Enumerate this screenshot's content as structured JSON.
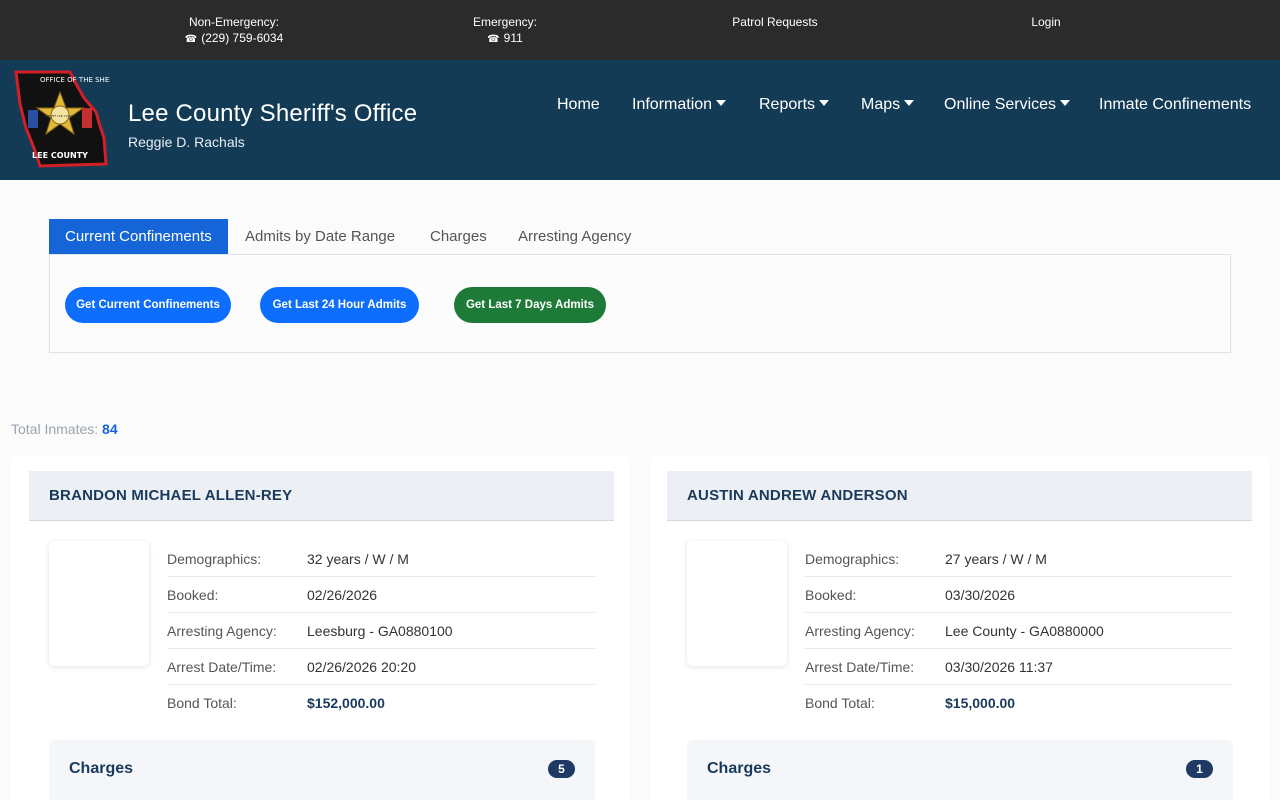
{
  "topbar": {
    "non_emergency_label": "Non-Emergency:",
    "non_emergency_phone": "(229) 759-6034",
    "emergency_label": "Emergency:",
    "emergency_phone": "911",
    "patrol_requests": "Patrol Requests",
    "login": "Login",
    "icon": "phone-icon"
  },
  "header": {
    "title": "Lee County Sheriff's Office",
    "subtitle": "Reggie D. Rachals",
    "logo_text_top": "OFFICE OF THE SHERIFF",
    "logo_text_bottom": "LEE COUNTY",
    "logo_star_text": "SHERIFF LEE COUNTY"
  },
  "nav": {
    "items": [
      {
        "label": "Home",
        "dropdown": false
      },
      {
        "label": "Information",
        "dropdown": true
      },
      {
        "label": "Reports",
        "dropdown": true
      },
      {
        "label": "Maps",
        "dropdown": true
      },
      {
        "label": "Online Services",
        "dropdown": true
      },
      {
        "label": "Inmate Confinements",
        "dropdown": false
      }
    ]
  },
  "tabs": {
    "items": [
      {
        "label": "Current Confinements",
        "active": true
      },
      {
        "label": "Admits by Date Range",
        "active": false
      },
      {
        "label": "Charges",
        "active": false
      },
      {
        "label": "Arresting Agency",
        "active": false
      }
    ]
  },
  "buttons": {
    "current": "Get Current Confinements",
    "last24": "Get Last 24 Hour Admits",
    "last7": "Get Last 7 Days Admits"
  },
  "total": {
    "label": "Total Inmates:",
    "count": "84"
  },
  "labels": {
    "demographics": "Demographics:",
    "booked": "Booked:",
    "agency": "Arresting Agency:",
    "arrest": "Arrest Date/Time:",
    "bond": "Bond Total:",
    "charges": "Charges"
  },
  "inmates": [
    {
      "name": "BRANDON MICHAEL ALLEN-REY",
      "demographics": "32 years / W / M",
      "booked": "02/26/2026",
      "agency": "Leesburg - GA0880100",
      "arrest": "02/26/2026 20:20",
      "bond": "$152,000.00",
      "charges_count": "5"
    },
    {
      "name": "AUSTIN ANDREW ANDERSON",
      "demographics": "27 years / W / M",
      "booked": "03/30/2026",
      "agency": "Lee County - GA0880000",
      "arrest": "03/30/2026 11:37",
      "bond": "$15,000.00",
      "charges_count": "1"
    }
  ],
  "colors": {
    "topbar": "#2b2b2b",
    "header": "#143b56",
    "primary": "#0d6efd",
    "success": "#1e7a37",
    "badge": "#1f3b63"
  }
}
